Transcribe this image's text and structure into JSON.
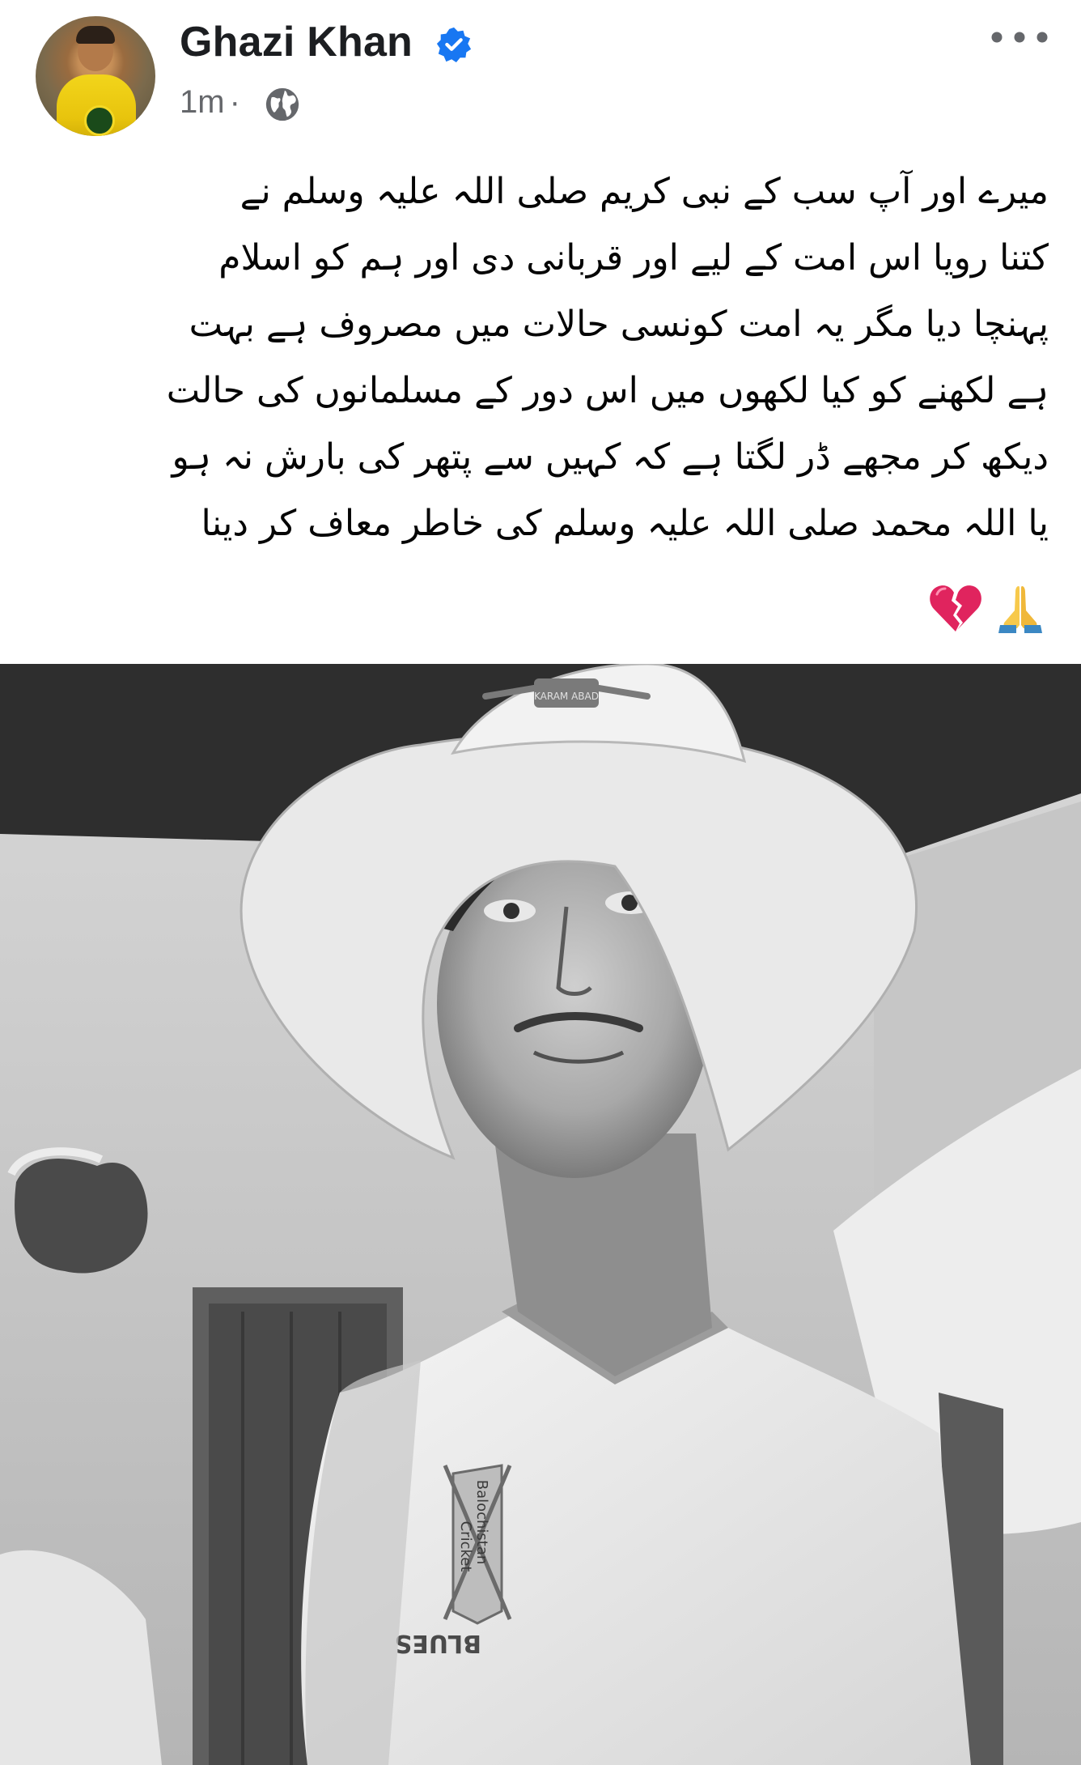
{
  "post": {
    "author_name": "Ghazi Khan",
    "time": "1m",
    "separator": "·",
    "privacy_icon": "globe-icon",
    "verified_icon": "verified-badge-icon",
    "more_icon": "more-options-icon",
    "text_lines": [
      "میرے اور آپ سب کے نبی کریم صلی اللہ علیہ وسلم نے",
      "کتنا رویا اس امت کے لیے اور قربانی دی اور ہم کو اسلام",
      "پہنچا دیا مگر یہ امت کونسی حالات میں مصروف ہے بہت",
      "ہے لکھنے کو کیا لکھوں میں اس دور کے مسلمانوں کی حالت",
      "دیکھ کر مجھے ڈر لگتا ہے کہ کہیں سے پتھر کی بارش نہ ہو",
      "یا اللہ محمد صلی اللہ علیہ وسلم کی خاطر معاف کر دینا"
    ],
    "emojis": [
      "broken-heart-icon",
      "folded-hands-icon"
    ],
    "photo": {
      "subject": "photo",
      "cap_text": "KARAM ABAD",
      "shirt_text_1": "Balochistan",
      "shirt_text_2": "Cricket",
      "shirt_text_3": "BLUES"
    }
  },
  "colors": {
    "verified_blue": "#1877f2",
    "secondary_text": "#65676b",
    "primary_text": "#050505"
  }
}
